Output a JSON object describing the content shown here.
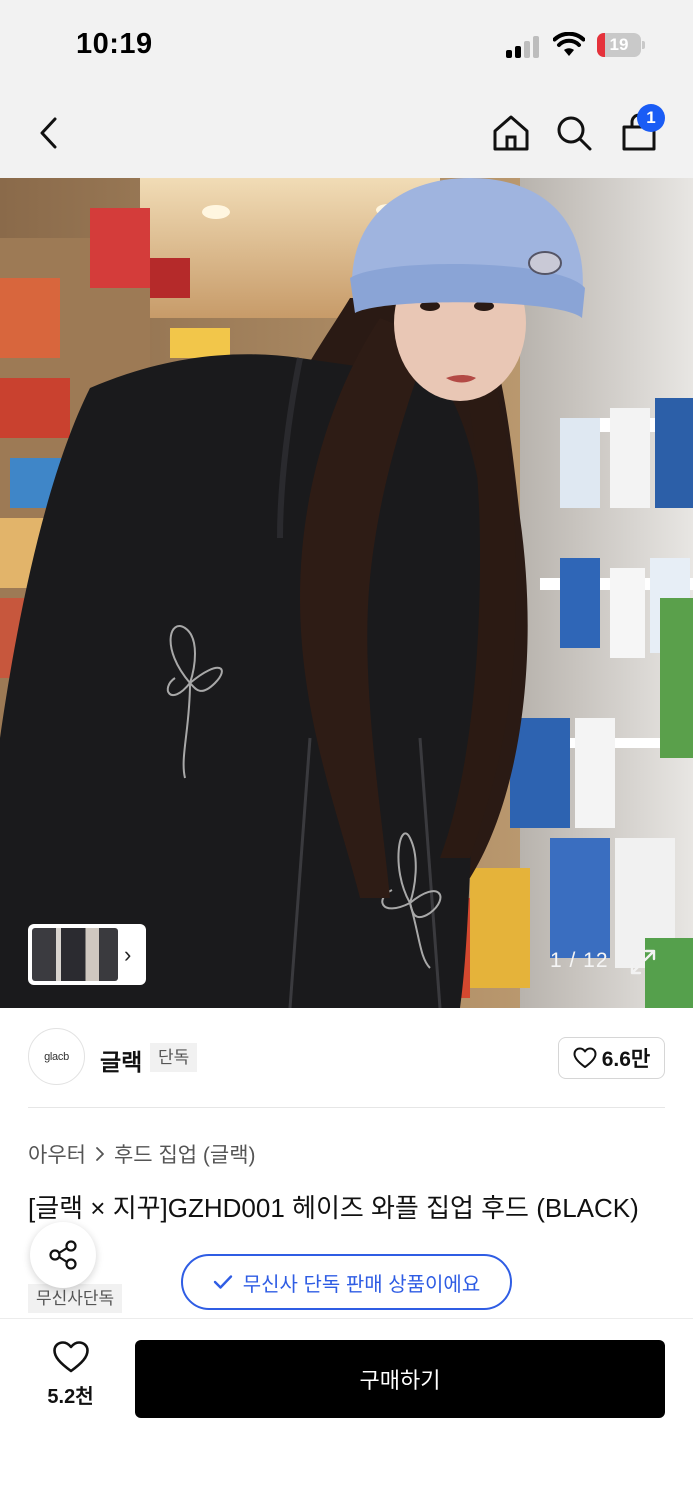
{
  "status_bar": {
    "time": "10:19",
    "battery_level": "19",
    "battery_fraction": 0.19,
    "battery_color": "#e5323b"
  },
  "nav": {
    "back_icon": "chevron-left-icon",
    "home_icon": "home-icon",
    "search_icon": "search-icon",
    "cart_icon": "shopping-bag-icon",
    "cart_count": "1",
    "badge_color": "#1a5cf5"
  },
  "gallery": {
    "counter": "1 / 12",
    "expand_icon": "expand-icon",
    "thumb_arrow": "›"
  },
  "brand": {
    "logo_text": "glacb",
    "name": "글랙",
    "tag": "단독",
    "like_count": "6.6만"
  },
  "product": {
    "breadcrumb": [
      "아우터",
      "후드 집업 (글랙)"
    ],
    "title": "[글랙 × 지꾸]GZHD001 헤이즈 와플 집업 후드 (BLACK)",
    "exclusive_tag": "무신사단독",
    "exclusive_notice": "무신사 단독 판매 상품이에요",
    "accent_color": "#2f5de4"
  },
  "bottom_bar": {
    "wish_count": "5.2천",
    "buy_label": "구매하기"
  }
}
